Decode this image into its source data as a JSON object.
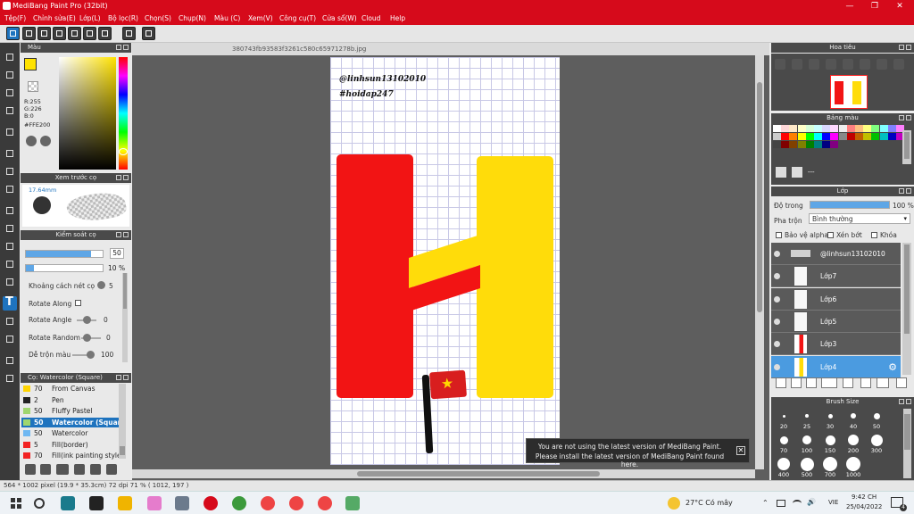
{
  "window": {
    "title": "MediBang Paint Pro (32bit)",
    "min": "—",
    "max": "❐",
    "close": "✕"
  },
  "menu": [
    "Tệp(F)",
    "Chỉnh sửa(E)",
    "Lớp(L)",
    "Bộ lọc(R)",
    "Chọn(S)",
    "Chụp(N)",
    "Màu (C)",
    "Xem(V)",
    "Công cụ(T)",
    "Cửa sổ(W)",
    "Cloud",
    "Help"
  ],
  "document": {
    "tab": "380743fb93583f3261c580c65971278b.jpg",
    "handle": "@linhsun13102010",
    "tag": "#hoidap247"
  },
  "color_panel": {
    "title": "Màu",
    "r": "R:255",
    "g": "G:226",
    "b": "B:0",
    "hex": "#FFE200",
    "primary": "#ffe200",
    "secondary": "#ffffff"
  },
  "brush_preview": {
    "title": "Xem trước cọ",
    "size": "17.64mm"
  },
  "brush_control": {
    "title": "Kiểm soát cọ",
    "size_value": "50",
    "size_fill": 0.85,
    "opacity_value": "10",
    "opacity_unit": "%",
    "opacity_fill": 0.1,
    "spacing_label": "Khoảng cách nét cọ",
    "spacing_value": "5",
    "rotate_along_label": "Rotate Along",
    "rotate_angle_label": "Rotate Angle",
    "rotate_angle_value": "0",
    "rotate_random_label": "Rotate Random",
    "rotate_random_value": "0",
    "mix_label": "Dễ trộn màu",
    "mix_value": "100"
  },
  "brush_list": {
    "title": "Cọ: Watercolor (Square)",
    "items": [
      {
        "num": "70",
        "name": "From Canvas",
        "color": "#ffd400"
      },
      {
        "num": "2",
        "name": "Pen",
        "color": "#222222"
      },
      {
        "num": "50",
        "name": "Fluffy Pastel",
        "color": "#9fd66e"
      },
      {
        "num": "50",
        "name": "Watercolor (Square)",
        "color": "#9fd66e",
        "selected": true
      },
      {
        "num": "50",
        "name": "Watercolor",
        "color": "#6fb8f2"
      },
      {
        "num": "5",
        "name": "Fill(border)",
        "color": "#f22222"
      },
      {
        "num": "70",
        "name": "Fill(ink painting style b",
        "color": "#f22222"
      }
    ]
  },
  "navigator": {
    "title": "Hoa tiêu"
  },
  "palette": {
    "title": "Bảng màu",
    "name": "---"
  },
  "layers": {
    "title": "Lớp",
    "opacity_label": "Độ trong",
    "opacity_value": "100 %",
    "blend_label": "Pha trộn",
    "blend_value": "Bình thường",
    "protect_alpha": "Bảo vệ alpha",
    "clipping": "Xén bớt",
    "lock": "Khóa",
    "items": [
      {
        "name": "@linhsun13102010"
      },
      {
        "name": "Lớp7"
      },
      {
        "name": "Lớp6"
      },
      {
        "name": "Lớp5"
      },
      {
        "name": "Lớp3"
      },
      {
        "name": "Lớp4",
        "selected": true
      }
    ]
  },
  "brush_size": {
    "title": "Brush Size",
    "sizes": [
      "20",
      "25",
      "30",
      "40",
      "50",
      "70",
      "100",
      "150",
      "200",
      "300",
      "400",
      "500",
      "700",
      "1000"
    ]
  },
  "notice": {
    "line1": "You are not using the latest version of MediBang Paint.",
    "line2": "Please install the latest version of MediBang Paint found here."
  },
  "status": {
    "text": "564 * 1002 pixel  (19.9 * 35.3cm)  72 dpi  71 %  ( 1012, 197 )"
  },
  "taskbar": {
    "weather": "27°C  Có mây",
    "lang": "VIE",
    "time": "9:42 CH",
    "date": "25/04/2022",
    "notif_count": "4"
  }
}
